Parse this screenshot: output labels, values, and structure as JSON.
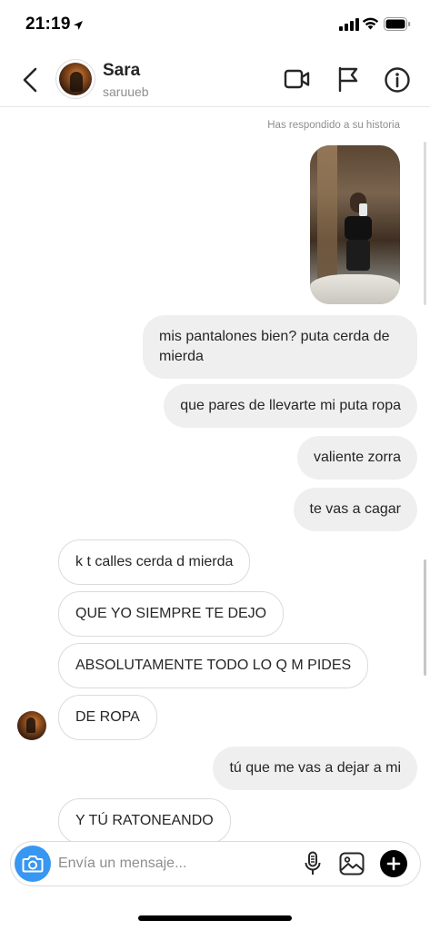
{
  "status_bar": {
    "time": "21:19",
    "icons": [
      "location-arrow-icon",
      "cellular-signal-icon",
      "wifi-icon",
      "battery-icon"
    ]
  },
  "header": {
    "contact_name": "Sara",
    "contact_username": "saruueb",
    "icons": [
      "back-chevron-icon",
      "video-camera-icon",
      "flag-icon",
      "info-icon"
    ]
  },
  "thread": {
    "story_reply_label": "Has respondido a su historia",
    "messages": [
      {
        "direction": "out",
        "text": "mis pantalones bien? puta cerda de mierda"
      },
      {
        "direction": "out",
        "text": "que pares de llevarte mi puta ropa"
      },
      {
        "direction": "out",
        "text": "valiente zorra"
      },
      {
        "direction": "out",
        "text": "te vas a cagar"
      },
      {
        "direction": "in",
        "text": "k t calles cerda d mierda"
      },
      {
        "direction": "in",
        "text": "QUE YO SIEMPRE TE DEJO"
      },
      {
        "direction": "in",
        "text": "ABSOLUTAMENTE TODO LO Q M PIDES"
      },
      {
        "direction": "in",
        "text": "DE ROPA"
      },
      {
        "direction": "out",
        "text": "tú que me vas a dejar a mi"
      },
      {
        "direction": "in",
        "text": "Y TÚ RATONEANDO"
      }
    ]
  },
  "composer": {
    "placeholder": "Envía un mensaje...",
    "value": "",
    "icons": [
      "camera-icon",
      "microphone-icon",
      "gallery-icon",
      "plus-icon"
    ]
  },
  "colors": {
    "outgoing_bubble": "#efefef",
    "incoming_border": "#dbdbdb",
    "camera_accent": "#3897f0",
    "secondary_text": "#8e8e8e"
  }
}
